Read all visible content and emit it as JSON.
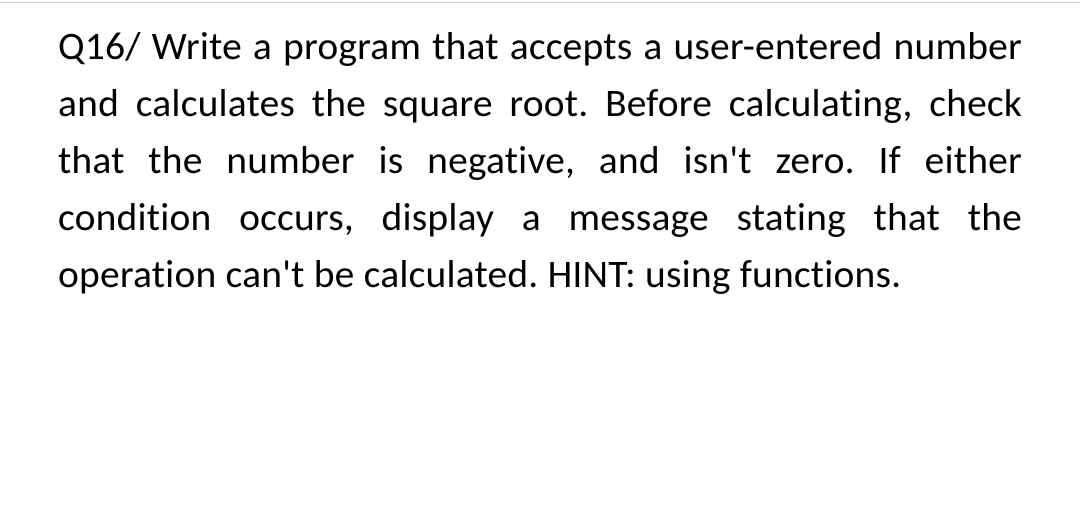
{
  "question": {
    "prefix": "Q16/",
    "body": " Write a program that accepts a user-entered number and calculates the square root. Before calculating, check that the number is negative, and isn't zero. If either condition occurs, display a message stating that the operation can't be calculated. HINT: using functions."
  }
}
